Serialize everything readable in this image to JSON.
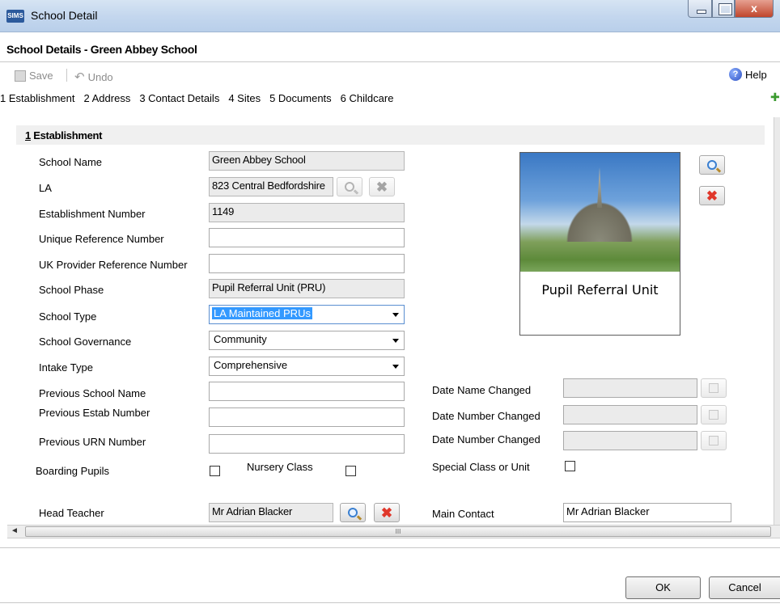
{
  "window": {
    "app_icon": "SIMS",
    "title": "School Detail",
    "close_glyph": "x"
  },
  "header": {
    "title": "School Details - Green Abbey School"
  },
  "toolbar": {
    "save_label": "Save",
    "undo_label": "Undo",
    "help_label": "Help",
    "help_icon": "?"
  },
  "tabs": [
    {
      "label": "1 Establishment"
    },
    {
      "label": "2 Address"
    },
    {
      "label": "3 Contact Details"
    },
    {
      "label": "4 Sites"
    },
    {
      "label": "5 Documents"
    },
    {
      "label": "6 Childcare"
    }
  ],
  "section": {
    "number": "1",
    "title": " Establishment"
  },
  "form": {
    "school_name": {
      "label": "School Name",
      "value": "Green Abbey School"
    },
    "la": {
      "label": "LA",
      "value": "823 Central Bedfordshire"
    },
    "establishment_number": {
      "label": "Establishment Number",
      "value": "1149"
    },
    "urn": {
      "label": "Unique Reference Number",
      "value": ""
    },
    "ukprn": {
      "label": "UK Provider Reference Number",
      "value": ""
    },
    "school_phase": {
      "label": "School Phase",
      "value": "Pupil Referral Unit (PRU)"
    },
    "school_type": {
      "label": "School Type",
      "value": "LA Maintained PRUs"
    },
    "school_governance": {
      "label": "School Governance",
      "value": "Community"
    },
    "intake_type": {
      "label": "Intake Type",
      "value": "Comprehensive"
    },
    "previous_school_name": {
      "label": "Previous School Name",
      "value": ""
    },
    "previous_estab_number": {
      "label": "Previous Estab Number",
      "value": ""
    },
    "previous_urn": {
      "label": "Previous URN Number",
      "value": ""
    },
    "boarding_pupils": {
      "label": "Boarding Pupils",
      "checked": false
    },
    "nursery_class": {
      "label": "Nursery Class",
      "checked": false
    },
    "special_class": {
      "label": "Special Class or Unit",
      "checked": false
    },
    "date_name_changed": {
      "label": "Date Name Changed",
      "value": ""
    },
    "date_number_changed_1": {
      "label": "Date Number Changed",
      "value": ""
    },
    "date_number_changed_2": {
      "label": "Date Number Changed",
      "value": ""
    },
    "head_teacher": {
      "label": "Head Teacher",
      "value": "Mr Adrian Blacker"
    },
    "main_contact": {
      "label": "Main Contact",
      "value": "Mr Adrian Blacker"
    }
  },
  "picture": {
    "caption": "Pupil Referral Unit"
  },
  "scrollbar": {
    "grip": "III",
    "left_arrow": "◄"
  },
  "buttons": {
    "ok": "OK",
    "cancel": "Cancel"
  },
  "colors": {
    "titlebar": "#c4d7ee",
    "selection": "#3399ff",
    "close": "#c0462c"
  }
}
